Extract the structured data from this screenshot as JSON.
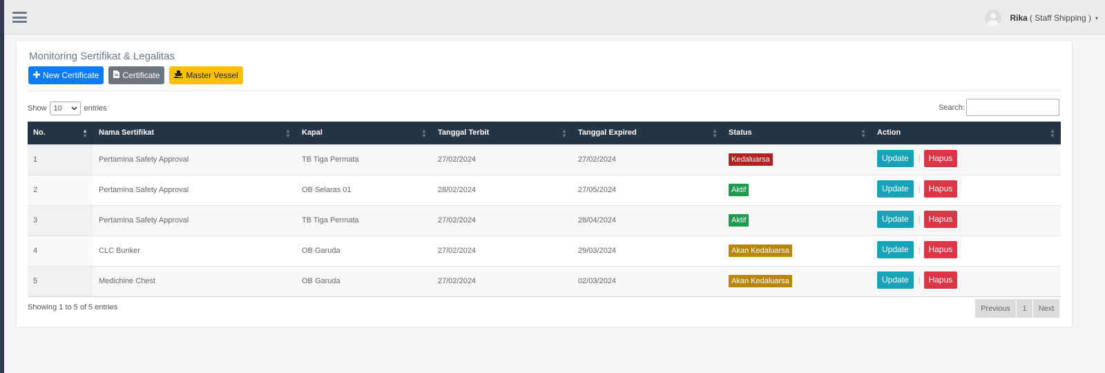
{
  "colors": {
    "sidebar_edge": "#2f3b4c",
    "table_header": "#253446",
    "primary": "#0d7cf2",
    "secondary": "#6d757d",
    "warning": "#fbc000",
    "info": "#17a2b8",
    "danger": "#dc3545",
    "success": "#1e9b4f",
    "expired": "#b22222",
    "expiring": "#b8860b"
  },
  "header": {
    "menu_icon": "hamburger-icon",
    "user_name": "Rika",
    "user_role": "( Staff Shipping )",
    "caret": "▾"
  },
  "page": {
    "title": "Monitoring Sertifikat & Legalitas",
    "buttons": {
      "new_certificate": "New Certificate",
      "certificate": "Certificate",
      "master_vessel": "Master Vessel"
    }
  },
  "table_controls": {
    "show_label": "Show",
    "page_length": "10",
    "entries_label": "entries",
    "search_label": "Search:",
    "search_value": ""
  },
  "table": {
    "columns": [
      "No.",
      "Nama Sertifikat",
      "Kapal",
      "Tanggal Terbit",
      "Tanggal Expired",
      "Status",
      "Action"
    ],
    "rows": [
      {
        "no": "1",
        "nama": "Pertamina Safety Approval",
        "kapal": "TB Tiga Permata",
        "terbit": "27/02/2024",
        "expired": "27/02/2024",
        "status": "Kedaluarsa",
        "status_color": "#b22222"
      },
      {
        "no": "2",
        "nama": "Pertamina Safety Approval",
        "kapal": "OB Selaras 01",
        "terbit": "28/02/2024",
        "expired": "27/05/2024",
        "status": "Aktif",
        "status_color": "#1e9b4f"
      },
      {
        "no": "3",
        "nama": "Pertamina Safety Approval",
        "kapal": "TB Tiga Permata",
        "terbit": "27/02/2024",
        "expired": "28/04/2024",
        "status": "Aktif",
        "status_color": "#1e9b4f"
      },
      {
        "no": "4",
        "nama": "CLC Bunker",
        "kapal": "OB Garuda",
        "terbit": "27/02/2024",
        "expired": "29/03/2024",
        "status": "Akan Kedaluarsa",
        "status_color": "#b8860b"
      },
      {
        "no": "5",
        "nama": "Medichine Chest",
        "kapal": "OB Garuda",
        "terbit": "27/02/2024",
        "expired": "02/03/2024",
        "status": "Akan Kedaluarsa",
        "status_color": "#b8860b"
      }
    ],
    "action_update": "Update",
    "action_separator": "|",
    "action_delete": "Hapus"
  },
  "footer": {
    "info": "Showing 1 to 5 of 5 entries",
    "previous": "Previous",
    "page": "1",
    "next": "Next"
  }
}
